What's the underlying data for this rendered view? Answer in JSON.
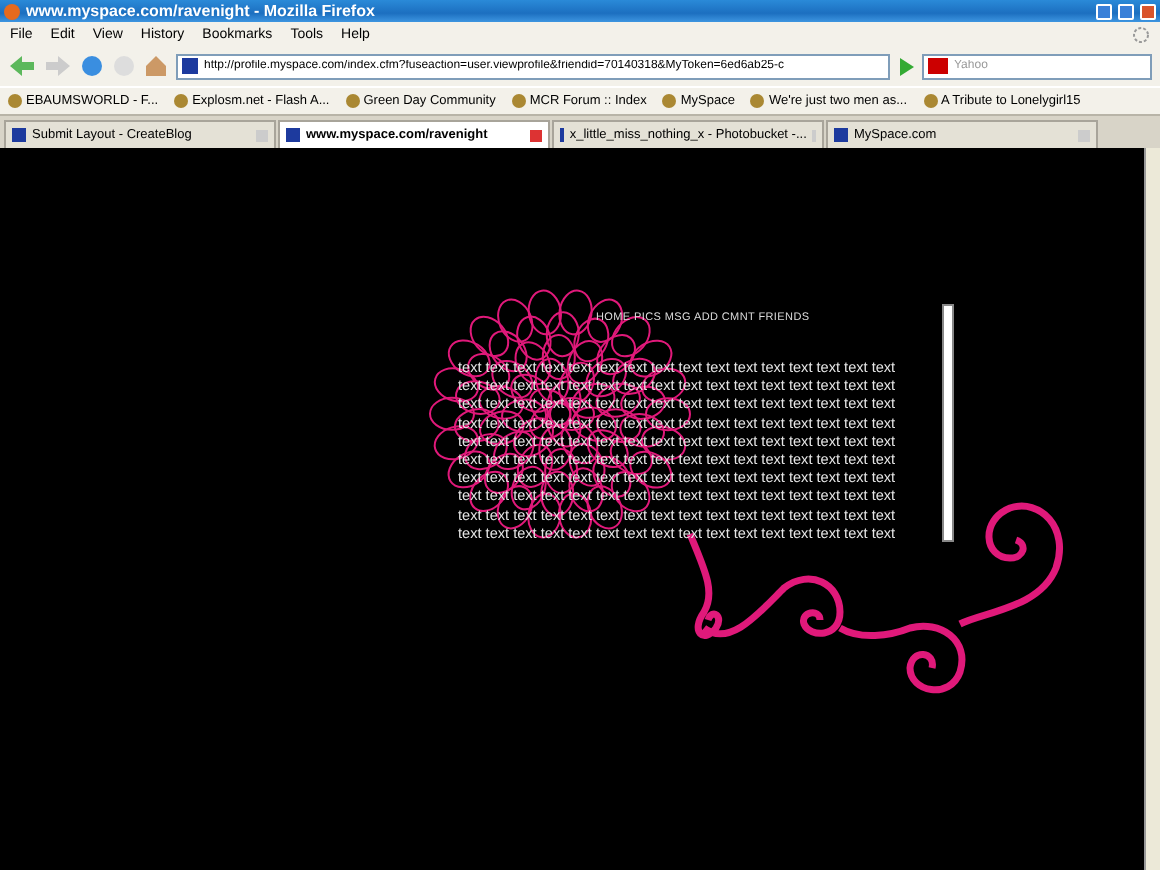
{
  "window": {
    "title": "www.myspace.com/ravenight - Mozilla Firefox"
  },
  "menu": [
    "File",
    "Edit",
    "View",
    "History",
    "Bookmarks",
    "Tools",
    "Help"
  ],
  "address_bar": {
    "value": "http://profile.myspace.com/index.cfm?fuseaction=user.viewprofile&friendid=70140318&MyToken=6ed6ab25-c"
  },
  "search": {
    "placeholder": "Yahoo"
  },
  "bookmarks": [
    {
      "label": "EBAUMSWORLD - F..."
    },
    {
      "label": "Explosm.net - Flash A..."
    },
    {
      "label": "Green Day Community"
    },
    {
      "label": "MCR Forum :: Index"
    },
    {
      "label": "MySpace"
    },
    {
      "label": "We're just two men as..."
    },
    {
      "label": "A Tribute to Lonelygirl15"
    }
  ],
  "tabs": [
    {
      "label": "Submit Layout - CreateBlog",
      "selected": false
    },
    {
      "label": "www.myspace.com/ravenight",
      "selected": true
    },
    {
      "label": "x_little_miss_nothing_x - Photobucket -...",
      "selected": false
    },
    {
      "label": "MySpace.com",
      "selected": false
    }
  ],
  "page": {
    "nav": "HOME PICS MSG ADD CMNT FRIENDS",
    "lines": [
      "text text text text text text text text text text text text text text text text",
      "text text text text text text text text text text text text text text text text",
      "text text text text text text text text text text text text text text text text",
      "text text text text text text text text text text text text text text text text",
      "text text text text text text text text text text text text text text text text",
      "text text text text text text text text text text text text text text text text",
      "text text text text text text text text text text text text text text text text",
      "text text text text text text text text text text text text text text text text",
      "text text text text text text text text text text text text text text text text",
      "text text text text text text text text text text text text text text text text"
    ]
  }
}
